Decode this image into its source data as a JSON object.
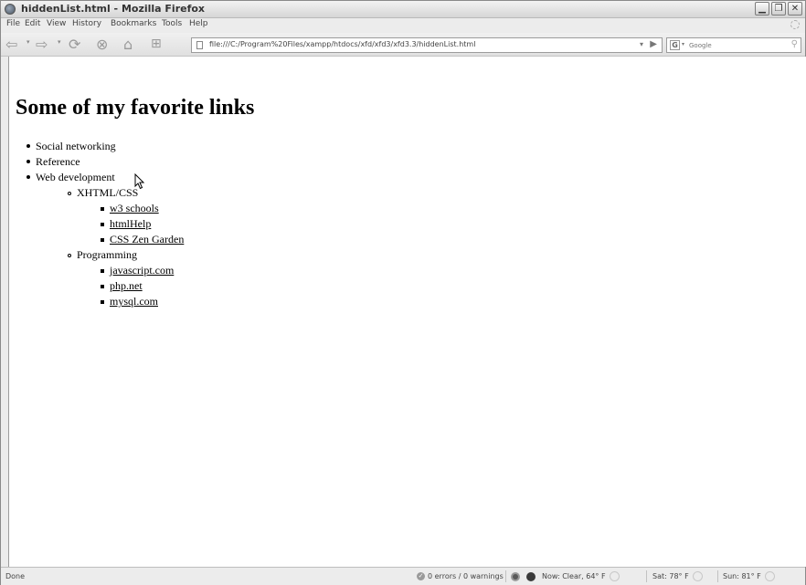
{
  "window": {
    "title": "hiddenList.html - Mozilla Firefox"
  },
  "menu": {
    "items": [
      "File",
      "Edit",
      "View",
      "History",
      "Bookmarks",
      "Tools",
      "Help"
    ]
  },
  "navigation": {
    "url": "file:///C:/Program%20Files/xampp/htdocs/xfd/xfd3/xfd3.3/hiddenList.html",
    "search_engine_label": "G",
    "search_placeholder": "Google"
  },
  "page": {
    "heading": "Some of my favorite links",
    "list": [
      {
        "label": "Social networking"
      },
      {
        "label": "Reference"
      },
      {
        "label": "Web development",
        "children": [
          {
            "label": "XHTML/CSS",
            "links": [
              "w3 schools",
              "htmlHelp",
              "CSS Zen Garden"
            ]
          },
          {
            "label": "Programming",
            "links": [
              "javascript.com",
              "php.net",
              "mysql.com"
            ]
          }
        ]
      }
    ]
  },
  "statusbar": {
    "status": "Done",
    "validator": "0 errors / 0 warnings",
    "weather_now": "Now: Clear, 64° F",
    "weather_sat": "Sat: 78° F",
    "weather_sun": "Sun: 81° F"
  }
}
